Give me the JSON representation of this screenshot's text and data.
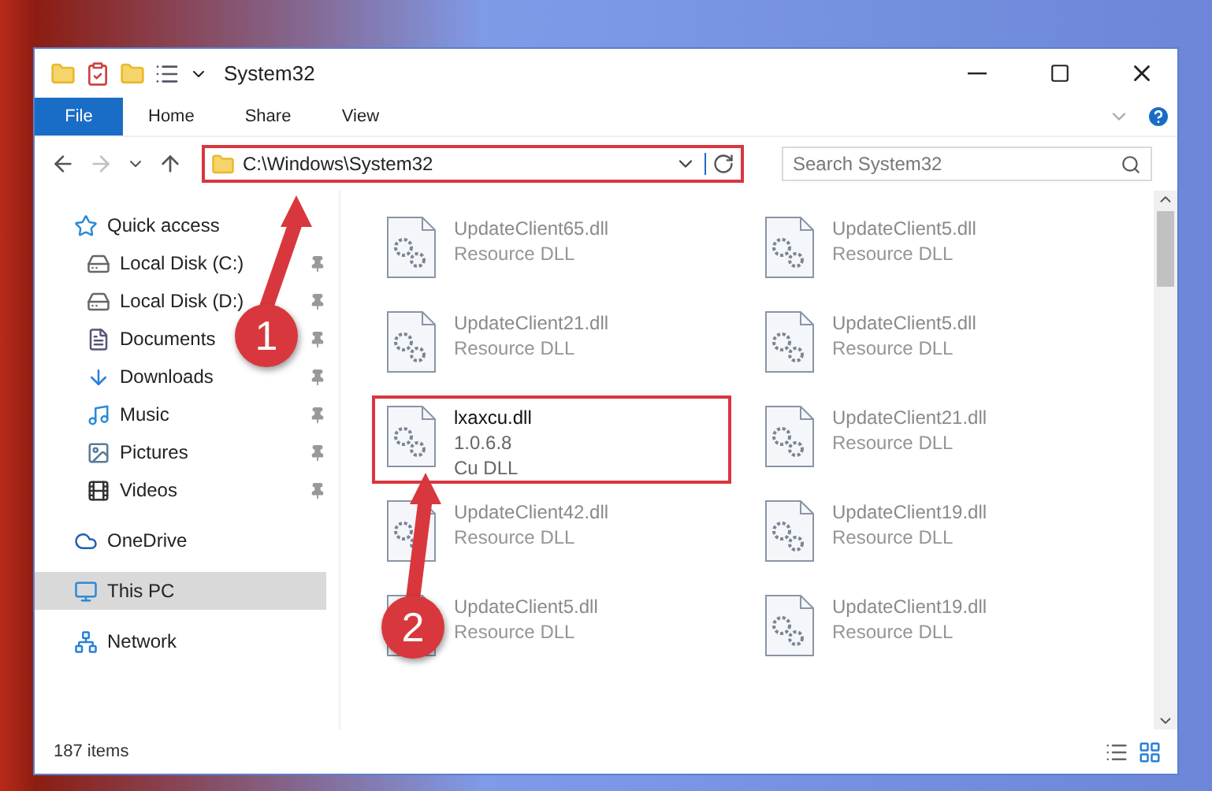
{
  "window": {
    "title": "System32"
  },
  "ribbon_tabs": [
    {
      "label": "File",
      "selected": true
    },
    {
      "label": "Home",
      "selected": false
    },
    {
      "label": "Share",
      "selected": false
    },
    {
      "label": "View",
      "selected": false
    }
  ],
  "navigation": {
    "forward_disabled": true
  },
  "address": {
    "path": "C:\\Windows\\System32",
    "highlighted": true
  },
  "search": {
    "placeholder": "Search System32"
  },
  "sidebar": {
    "items": [
      {
        "label": "Quick access",
        "kind": "group",
        "selected": false
      },
      {
        "label": "Local Disk (C:)",
        "kind": "pinned",
        "selected": false
      },
      {
        "label": "Local Disk (D:)",
        "kind": "pinned",
        "selected": false
      },
      {
        "label": "Documents",
        "kind": "pinned",
        "selected": false
      },
      {
        "label": "Downloads",
        "kind": "pinned",
        "selected": false
      },
      {
        "label": "Music",
        "kind": "pinned",
        "selected": false
      },
      {
        "label": "Pictures",
        "kind": "pinned",
        "selected": false
      },
      {
        "label": "Videos",
        "kind": "pinned",
        "selected": false
      },
      {
        "label": "OneDrive",
        "kind": "group",
        "selected": false
      },
      {
        "label": "This PC",
        "kind": "group",
        "selected": true
      },
      {
        "label": "Network",
        "kind": "group",
        "selected": false
      }
    ]
  },
  "files": [
    {
      "name": "UpdateClient65.dll",
      "type": "Resource DLL",
      "faded": true,
      "highlighted": false
    },
    {
      "name": "UpdateClient5.dll",
      "type": "Resource DLL",
      "faded": true,
      "highlighted": false
    },
    {
      "name": "UpdateClient21.dll",
      "type": "Resource DLL",
      "faded": true,
      "highlighted": false
    },
    {
      "name": "UpdateClient5.dll",
      "type": "Resource DLL",
      "faded": true,
      "highlighted": false
    },
    {
      "name": "lxaxcu.dll",
      "version": "1.0.6.8",
      "type": "Cu DLL",
      "faded": false,
      "highlighted": true
    },
    {
      "name": "UpdateClient21.dll",
      "type": "Resource DLL",
      "faded": true,
      "highlighted": false
    },
    {
      "name": "UpdateClient42.dll",
      "type": "Resource DLL",
      "faded": true,
      "highlighted": false
    },
    {
      "name": "UpdateClient19.dll",
      "type": "Resource DLL",
      "faded": true,
      "highlighted": false
    },
    {
      "name": "UpdateClient5.dll",
      "type": "Resource DLL",
      "faded": true,
      "highlighted": false
    },
    {
      "name": "UpdateClient19.dll",
      "type": "Resource DLL",
      "faded": true,
      "highlighted": false
    }
  ],
  "status_bar": {
    "count": "187 items"
  },
  "annotations": [
    {
      "number": "1"
    },
    {
      "number": "2"
    }
  ]
}
